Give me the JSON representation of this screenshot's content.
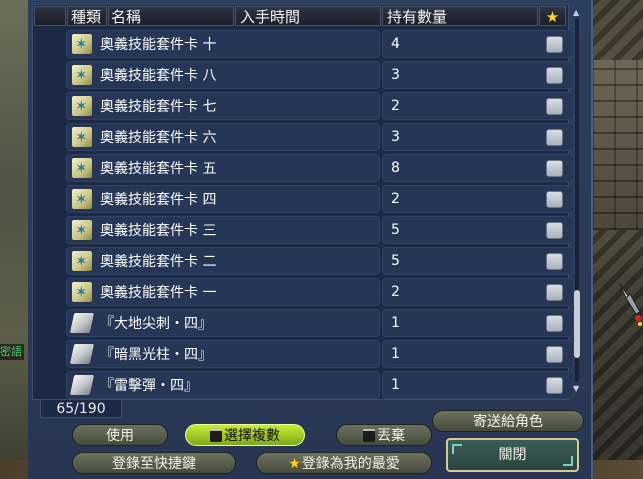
{
  "window": {
    "title": ""
  },
  "columns": {
    "type": "種類",
    "name": "名稱",
    "acquired": "入手時間",
    "quantity": "持有數量",
    "favorite_icon": "star-icon"
  },
  "items": [
    {
      "icon": "skill-card-icon",
      "name": "奧義技能套件卡 十",
      "quantity": "4"
    },
    {
      "icon": "skill-card-icon",
      "name": "奧義技能套件卡 八",
      "quantity": "3"
    },
    {
      "icon": "skill-card-icon",
      "name": "奧義技能套件卡 七",
      "quantity": "2"
    },
    {
      "icon": "skill-card-icon",
      "name": "奧義技能套件卡 六",
      "quantity": "3"
    },
    {
      "icon": "skill-card-icon",
      "name": "奧義技能套件卡 五",
      "quantity": "8"
    },
    {
      "icon": "skill-card-icon",
      "name": "奧義技能套件卡 四",
      "quantity": "2"
    },
    {
      "icon": "skill-card-icon",
      "name": "奧義技能套件卡 三",
      "quantity": "5"
    },
    {
      "icon": "skill-card-icon",
      "name": "奧義技能套件卡 二",
      "quantity": "5"
    },
    {
      "icon": "skill-card-icon",
      "name": "奧義技能套件卡 一",
      "quantity": "2"
    },
    {
      "icon": "scroll-icon",
      "name": "『大地尖刺・四』",
      "quantity": "1"
    },
    {
      "icon": "scroll-icon",
      "name": "『暗黑光柱・四』",
      "quantity": "1"
    },
    {
      "icon": "scroll-icon",
      "name": "『雷擊彈・四』",
      "quantity": "1"
    }
  ],
  "count": "65/190",
  "buttons": {
    "use": "使用",
    "multi_select": "選擇複數",
    "discard": "丟棄",
    "send_to_character": "寄送給角色",
    "register_shortcut": "登錄至快捷鍵",
    "register_favorite": "登錄為我的最愛",
    "close": "關閉"
  },
  "background": {
    "chat_text": "密語"
  },
  "colors": {
    "panel": "#2a3a58",
    "active_button": "#a6d22a",
    "star": "#ffd23a"
  }
}
